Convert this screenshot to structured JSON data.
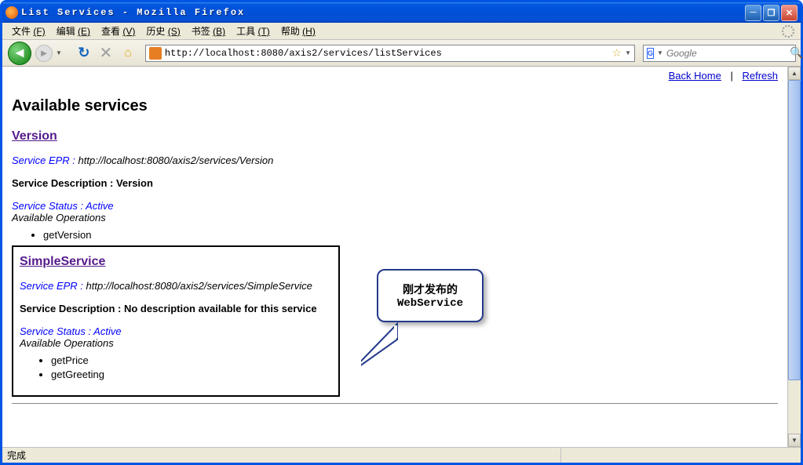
{
  "window": {
    "title": "List Services - Mozilla Firefox"
  },
  "menubar": {
    "items": [
      {
        "label": "文件",
        "acc": "(F)"
      },
      {
        "label": "编辑",
        "acc": "(E)"
      },
      {
        "label": "查看",
        "acc": "(V)"
      },
      {
        "label": "历史",
        "acc": "(S)"
      },
      {
        "label": "书签",
        "acc": "(B)"
      },
      {
        "label": "工具",
        "acc": "(T)"
      },
      {
        "label": "帮助",
        "acc": "(H)"
      }
    ]
  },
  "toolbar": {
    "url": "http://localhost:8080/axis2/services/listServices",
    "search_placeholder": "Google",
    "search_engine_label": "G"
  },
  "top_links": {
    "back_home": "Back Home",
    "refresh": "Refresh"
  },
  "page": {
    "heading": "Available services",
    "labels": {
      "epr": "Service EPR : ",
      "desc": "Service Description : ",
      "status": "Service Status : ",
      "avail_ops": "Available Operations"
    },
    "services": [
      {
        "name": "Version",
        "epr": "http://localhost:8080/axis2/services/Version",
        "description": "Version",
        "status": "Active",
        "operations": [
          "getVersion"
        ],
        "boxed": false
      },
      {
        "name": "SimpleService",
        "epr": "http://localhost:8080/axis2/services/SimpleService",
        "description": "No description available for this service",
        "status": "Active",
        "operations": [
          "getPrice",
          "getGreeting"
        ],
        "boxed": true
      }
    ]
  },
  "callout": {
    "line1": "刚才发布的",
    "line2": "WebService"
  },
  "statusbar": {
    "text": "完成"
  }
}
